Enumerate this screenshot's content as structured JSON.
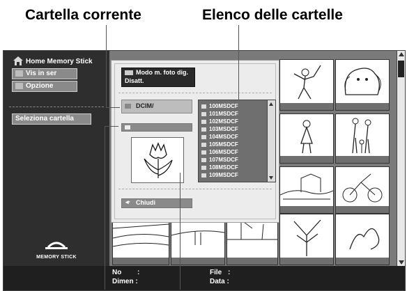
{
  "callouts": {
    "current_folder": "Cartella corrente",
    "folder_list": "Elenco delle cartelle"
  },
  "sidebar": {
    "title": "Home Memory Stick",
    "view_series": "Vis in ser",
    "options": "Opzione",
    "select_folder": "Seleziona cartella",
    "logo_text": "MEMORY STICK"
  },
  "dialog": {
    "mode_label": "Modo m. foto dig.",
    "mode_value": "Disatt.",
    "current_folder": "DCIM/",
    "folders": [
      "100MSDCF",
      "101MSDCF",
      "102MSDCF",
      "103MSDCF",
      "104MSDCF",
      "105MSDCF",
      "106MSDCF",
      "107MSDCF",
      "108MSDCF",
      "109MSDCF"
    ],
    "close_label": "Chiudi"
  },
  "infobar": {
    "no_label": "No",
    "dimen_label": "Dimen :",
    "file_label": "File",
    "data_label": "Data :"
  }
}
